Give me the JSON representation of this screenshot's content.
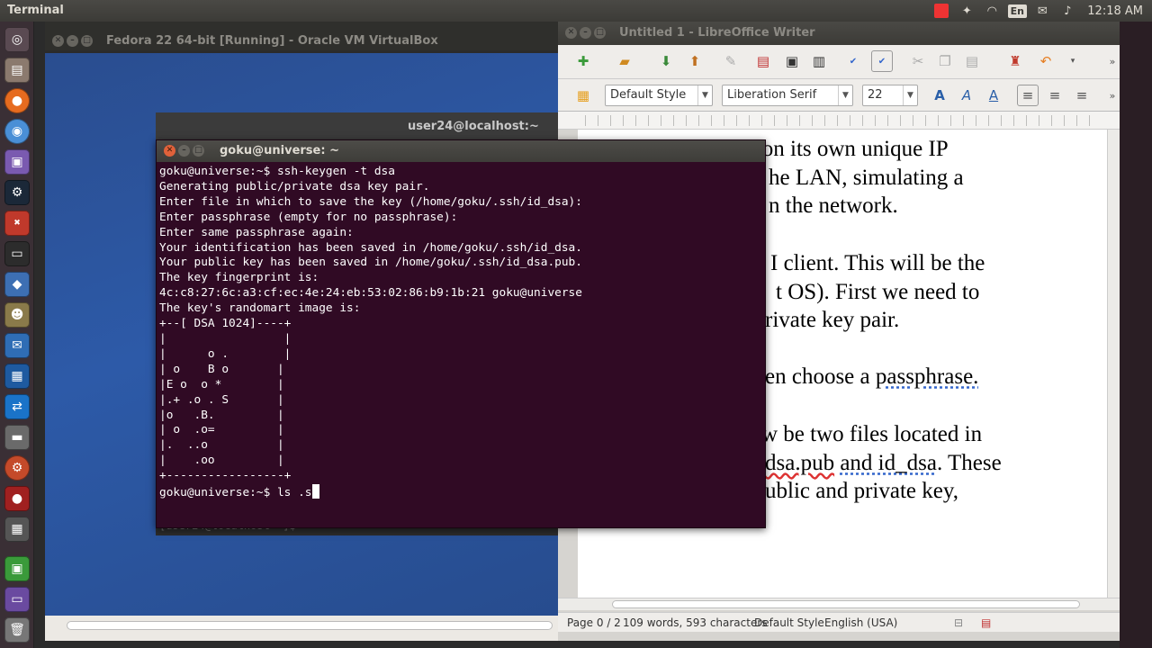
{
  "top_panel": {
    "app_title": "Terminal",
    "indicators": [
      "red-app-icon",
      "dropbox-icon",
      "wifi-icon",
      "keyboard-layout",
      "mail-icon",
      "volume-icon"
    ],
    "keyboard_layout": "En",
    "clock": "12:18 AM"
  },
  "launcher": {
    "items": [
      "dash-home",
      "files",
      "firefox",
      "chromium",
      "image-viewer",
      "steam",
      "crossover",
      "terminal",
      "drop",
      "gimp",
      "thunderbird",
      "virtualbox",
      "teamviewer",
      "drive",
      "settings",
      "red-app",
      "workspace",
      "green-app",
      "screen-app",
      "trash"
    ]
  },
  "vbox": {
    "title": "Fedora 22 64-bit [Running] - Oracle VM VirtualBox",
    "vm_terminal_title": "user24@localhost:~",
    "vm_terminal_prompt": "[user24@localhost ~]$"
  },
  "terminal": {
    "title": "goku@universe: ~",
    "lines": [
      "goku@universe:~$ ssh-keygen -t dsa",
      "Generating public/private dsa key pair.",
      "Enter file in which to save the key (/home/goku/.ssh/id_dsa):",
      "Enter passphrase (empty for no passphrase):",
      "Enter same passphrase again:",
      "Your identification has been saved in /home/goku/.ssh/id_dsa.",
      "Your public key has been saved in /home/goku/.ssh/id_dsa.pub.",
      "The key fingerprint is:",
      "4c:c8:27:6c:a3:cf:ec:4e:24:eb:53:02:86:b9:1b:21 goku@universe",
      "The key's randomart image is:",
      "+--[ DSA 1024]----+",
      "|                 |",
      "|      o .        |",
      "| o    B o       |",
      "|E o  o *        |",
      "|.+ .o . S       |",
      "|o   .B.         |",
      "| o  .o=         |",
      "|.  ..o          |",
      "|    .oo         |",
      "+-----------------+"
    ],
    "current_input": "goku@universe:~$ ls .s"
  },
  "writer": {
    "title": "Untitled 1 - LibreOffice Writer",
    "paragraph_style": "Default Style",
    "font_name": "Liberation Serif",
    "font_size": "22",
    "doc_lines": [
      "n on its own unique IP",
      "he LAN, simulating a",
      "n the network.",
      "I client. This will be the",
      "t OS). First we need to",
      "rivate key pair.",
      "en choose a",
      "passphrase.",
      "w be two files located in",
      "dsa.pub",
      "and id_dsa",
      ". These",
      "ublic and private key,"
    ],
    "status": {
      "page": "Page 0 / 2",
      "words": "109 words, 593 characters",
      "style": "Default Style",
      "language": "English (USA)"
    }
  }
}
